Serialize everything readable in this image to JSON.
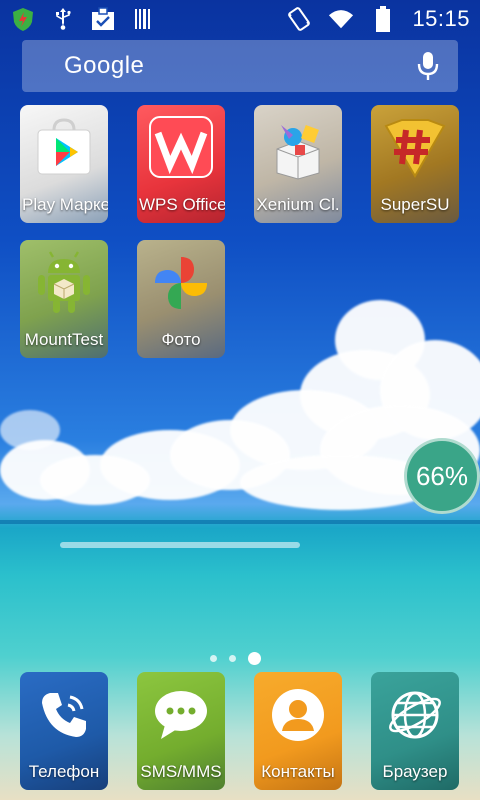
{
  "status_bar": {
    "time": "15:15",
    "left_icons": [
      "shield-app-icon",
      "usb-icon",
      "clipboard-check-icon",
      "barcode-icon"
    ],
    "right_icons": [
      "vibrate-icon",
      "wifi-icon",
      "battery-icon"
    ]
  },
  "search": {
    "logo_text": "Google",
    "mic_icon": "mic-icon"
  },
  "apps": [
    {
      "label": "Play Марке",
      "icon": "play-store-icon"
    },
    {
      "label": "WPS Office",
      "icon": "wps-office-icon"
    },
    {
      "label": "Xenium Cl.",
      "icon": "xenium-cleaner-icon"
    },
    {
      "label": "SuperSU",
      "icon": "supersu-icon"
    },
    {
      "label": "MountTest",
      "icon": "android-robot-icon"
    },
    {
      "label": "Фото",
      "icon": "photos-pinwheel-icon"
    }
  ],
  "battery_badge": "66%",
  "page_indicator": {
    "pages": 3,
    "current": 3
  },
  "dock": [
    {
      "label": "Телефон",
      "icon": "phone-icon",
      "color": "#1e5aa8"
    },
    {
      "label": "SMS/MMS",
      "icon": "chat-bubble-icon",
      "color": "#7ab533"
    },
    {
      "label": "Контакты",
      "icon": "contact-person-icon",
      "color": "#f29a1e"
    },
    {
      "label": "Браузер",
      "icon": "globe-icon",
      "color": "#2f8f88"
    }
  ]
}
